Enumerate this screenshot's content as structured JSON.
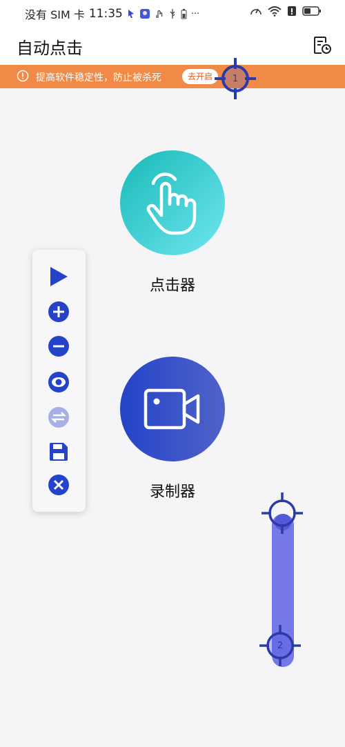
{
  "status_bar": {
    "carrier": "没有 SIM 卡",
    "time": "11:35",
    "more": "···"
  },
  "app": {
    "title": "自动点击",
    "history_icon": "history-list-icon"
  },
  "banner": {
    "text": "提高软件稳定性，防止被杀死",
    "button_label": "去开启",
    "icon": "info-icon"
  },
  "features": {
    "clicker": {
      "label": "点击器",
      "icon": "tap-hand-icon"
    },
    "recorder": {
      "label": "录制器",
      "icon": "video-camera-icon"
    }
  },
  "panel": {
    "buttons": [
      "play-icon",
      "add-icon",
      "remove-icon",
      "eye-icon",
      "swap-icon",
      "save-icon",
      "close-icon"
    ]
  },
  "targets": {
    "tap_point": {
      "number": "1"
    },
    "swipe": {
      "number": "2"
    }
  },
  "colors": {
    "banner": "#f08a46",
    "accent_blue": "#2443c8",
    "teal": "#19b9b7",
    "swipe": "#7678ea"
  }
}
